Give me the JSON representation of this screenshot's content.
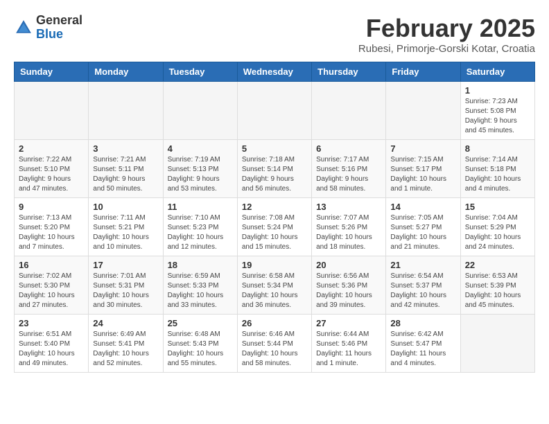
{
  "header": {
    "logo_general": "General",
    "logo_blue": "Blue",
    "title": "February 2025",
    "subtitle": "Rubesi, Primorje-Gorski Kotar, Croatia"
  },
  "weekdays": [
    "Sunday",
    "Monday",
    "Tuesday",
    "Wednesday",
    "Thursday",
    "Friday",
    "Saturday"
  ],
  "weeks": [
    [
      {
        "day": "",
        "info": ""
      },
      {
        "day": "",
        "info": ""
      },
      {
        "day": "",
        "info": ""
      },
      {
        "day": "",
        "info": ""
      },
      {
        "day": "",
        "info": ""
      },
      {
        "day": "",
        "info": ""
      },
      {
        "day": "1",
        "info": "Sunrise: 7:23 AM\nSunset: 5:08 PM\nDaylight: 9 hours and 45 minutes."
      }
    ],
    [
      {
        "day": "2",
        "info": "Sunrise: 7:22 AM\nSunset: 5:10 PM\nDaylight: 9 hours and 47 minutes."
      },
      {
        "day": "3",
        "info": "Sunrise: 7:21 AM\nSunset: 5:11 PM\nDaylight: 9 hours and 50 minutes."
      },
      {
        "day": "4",
        "info": "Sunrise: 7:19 AM\nSunset: 5:13 PM\nDaylight: 9 hours and 53 minutes."
      },
      {
        "day": "5",
        "info": "Sunrise: 7:18 AM\nSunset: 5:14 PM\nDaylight: 9 hours and 56 minutes."
      },
      {
        "day": "6",
        "info": "Sunrise: 7:17 AM\nSunset: 5:16 PM\nDaylight: 9 hours and 58 minutes."
      },
      {
        "day": "7",
        "info": "Sunrise: 7:15 AM\nSunset: 5:17 PM\nDaylight: 10 hours and 1 minute."
      },
      {
        "day": "8",
        "info": "Sunrise: 7:14 AM\nSunset: 5:18 PM\nDaylight: 10 hours and 4 minutes."
      }
    ],
    [
      {
        "day": "9",
        "info": "Sunrise: 7:13 AM\nSunset: 5:20 PM\nDaylight: 10 hours and 7 minutes."
      },
      {
        "day": "10",
        "info": "Sunrise: 7:11 AM\nSunset: 5:21 PM\nDaylight: 10 hours and 10 minutes."
      },
      {
        "day": "11",
        "info": "Sunrise: 7:10 AM\nSunset: 5:23 PM\nDaylight: 10 hours and 12 minutes."
      },
      {
        "day": "12",
        "info": "Sunrise: 7:08 AM\nSunset: 5:24 PM\nDaylight: 10 hours and 15 minutes."
      },
      {
        "day": "13",
        "info": "Sunrise: 7:07 AM\nSunset: 5:26 PM\nDaylight: 10 hours and 18 minutes."
      },
      {
        "day": "14",
        "info": "Sunrise: 7:05 AM\nSunset: 5:27 PM\nDaylight: 10 hours and 21 minutes."
      },
      {
        "day": "15",
        "info": "Sunrise: 7:04 AM\nSunset: 5:29 PM\nDaylight: 10 hours and 24 minutes."
      }
    ],
    [
      {
        "day": "16",
        "info": "Sunrise: 7:02 AM\nSunset: 5:30 PM\nDaylight: 10 hours and 27 minutes."
      },
      {
        "day": "17",
        "info": "Sunrise: 7:01 AM\nSunset: 5:31 PM\nDaylight: 10 hours and 30 minutes."
      },
      {
        "day": "18",
        "info": "Sunrise: 6:59 AM\nSunset: 5:33 PM\nDaylight: 10 hours and 33 minutes."
      },
      {
        "day": "19",
        "info": "Sunrise: 6:58 AM\nSunset: 5:34 PM\nDaylight: 10 hours and 36 minutes."
      },
      {
        "day": "20",
        "info": "Sunrise: 6:56 AM\nSunset: 5:36 PM\nDaylight: 10 hours and 39 minutes."
      },
      {
        "day": "21",
        "info": "Sunrise: 6:54 AM\nSunset: 5:37 PM\nDaylight: 10 hours and 42 minutes."
      },
      {
        "day": "22",
        "info": "Sunrise: 6:53 AM\nSunset: 5:39 PM\nDaylight: 10 hours and 45 minutes."
      }
    ],
    [
      {
        "day": "23",
        "info": "Sunrise: 6:51 AM\nSunset: 5:40 PM\nDaylight: 10 hours and 49 minutes."
      },
      {
        "day": "24",
        "info": "Sunrise: 6:49 AM\nSunset: 5:41 PM\nDaylight: 10 hours and 52 minutes."
      },
      {
        "day": "25",
        "info": "Sunrise: 6:48 AM\nSunset: 5:43 PM\nDaylight: 10 hours and 55 minutes."
      },
      {
        "day": "26",
        "info": "Sunrise: 6:46 AM\nSunset: 5:44 PM\nDaylight: 10 hours and 58 minutes."
      },
      {
        "day": "27",
        "info": "Sunrise: 6:44 AM\nSunset: 5:46 PM\nDaylight: 11 hours and 1 minute."
      },
      {
        "day": "28",
        "info": "Sunrise: 6:42 AM\nSunset: 5:47 PM\nDaylight: 11 hours and 4 minutes."
      },
      {
        "day": "",
        "info": ""
      }
    ]
  ]
}
